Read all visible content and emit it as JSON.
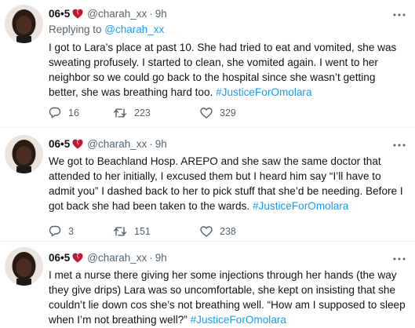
{
  "tweets": [
    {
      "name": "06•5",
      "handle": "@charah_xx",
      "dot": "·",
      "time": "9h",
      "replying_prefix": "Replying to ",
      "replying_to": "@charah_xx",
      "text": "I got to Lara’s place at past 10. She had tried to eat and vomited, she was sweating profusely. I started to clean, she vomited again. I went to her neighbor so we could go back to the hospital since she wasn’t getting better, she was breathing hard too.",
      "hashtag": "#JusticeForOmolara",
      "replies": "16",
      "retweets": "223",
      "likes": "329"
    },
    {
      "name": "06•5",
      "handle": "@charah_xx",
      "dot": "·",
      "time": "9h",
      "text": "We got to Beachland Hosp. AREPO and she saw the same doctor that attended to her initially, I excused them but I heard him say “I’ll have to admit you” I dashed back to her to pick stuff that she’d be needing. Before I got back she had been taken to the wards.",
      "hashtag": "#JusticeForOmolara",
      "replies": "3",
      "retweets": "151",
      "likes": "238"
    },
    {
      "name": "06•5",
      "handle": "@charah_xx",
      "dot": "·",
      "time": "9h",
      "text": "I met a nurse there giving her some injections through her hands (the way they give drips) Lara was so uncomfortable, she kept on insisting that she couldn’t lie down cos she’s not breathing well. “How am I supposed to sleep when I’m not breathing well?”",
      "hashtag": "#JusticeForOmolara"
    }
  ],
  "colors": {
    "accent": "#1d9bf0",
    "muted": "#536471",
    "heart": "#be1931"
  },
  "icons": [
    "broken-heart-icon",
    "more-icon",
    "reply-icon",
    "retweet-icon",
    "like-icon"
  ]
}
